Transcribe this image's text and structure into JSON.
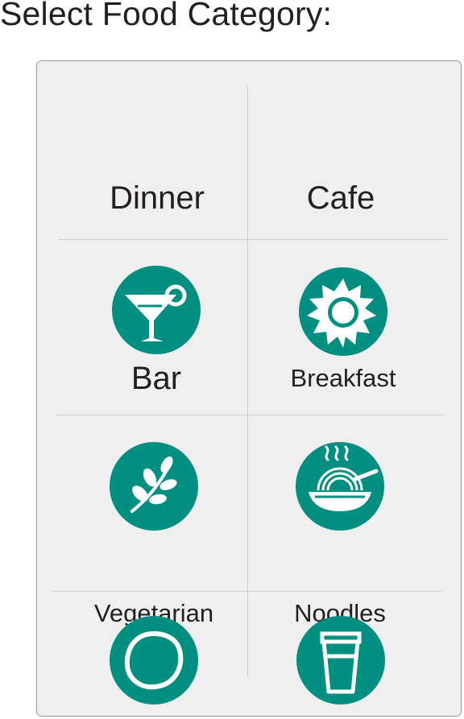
{
  "page": {
    "title": "Select Food Category:"
  },
  "colors": {
    "accent": "#008f80",
    "panel_bg": "#efefef",
    "divider": "#cfcfcf",
    "text": "#231f20"
  },
  "categories": [
    {
      "label": "Dinner",
      "icon": null
    },
    {
      "label": "Cafe",
      "icon": null
    },
    {
      "label": "Bar",
      "icon": "cocktail-icon"
    },
    {
      "label": "Breakfast",
      "icon": "sun-icon"
    },
    {
      "label": "Vegetarian",
      "icon": "leaf-icon"
    },
    {
      "label": "Noodles",
      "icon": "noodle-bowl-icon"
    },
    {
      "label": "",
      "icon": "lemon-icon"
    },
    {
      "label": "",
      "icon": "coffee-cup-icon"
    }
  ]
}
